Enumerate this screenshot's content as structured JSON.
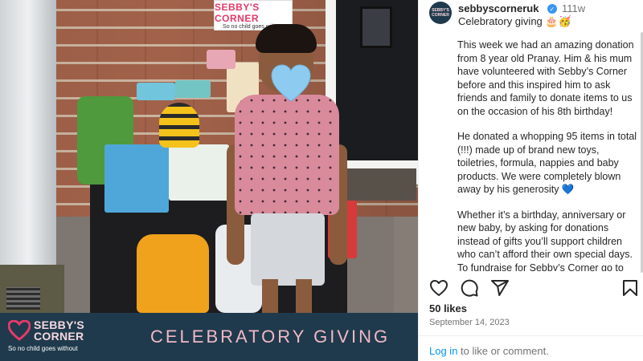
{
  "post": {
    "sign_logo": "SEBBY'S CORNER",
    "sign_tagline": "So no child goes without",
    "banner": {
      "logo_line1": "SEBBY'S",
      "logo_line2": "CORNER",
      "logo_tagline": "So no child goes without",
      "title": "CELEBRATORY GIVING"
    },
    "overlay_emoji": "blue-heart-emoji"
  },
  "header": {
    "avatar_text": "SEBBY'S CORNER",
    "username": "sebbyscorneruk",
    "time_ago": "111w",
    "caption_title": "Celebratory giving 🎂🥳"
  },
  "caption": {
    "p1": "This week we had an amazing donation from 8 year old Pranay. Him & his mum have volunteered with Sebby’s Corner before and this inspired him to ask friends and family to donate items to us on the occasion of his 8th birthday!",
    "p2": "He donated a whopping 95 items in total (!!!) made up of brand new toys, toiletries, formula, nappies and baby products. We were completely blown away by his generosity 💙",
    "p3": "Whether it’s a birthday, anniversary or new baby, by asking for donations instead of gifts you’ll support children who can’t afford their own special days. To fundraise for Sebby’s Corner go to our website."
  },
  "actions": {
    "icons": [
      "heart-icon",
      "comment-icon",
      "share-icon",
      "bookmark-icon"
    ]
  },
  "likes": "50 likes",
  "date": "September 14, 2023",
  "login": {
    "link": "Log in",
    "rest": " to like or comment."
  },
  "colors": {
    "brand_navy": "#1f3a4c",
    "brand_pink": "#e5396a",
    "link_blue": "#0095f6",
    "verified_blue": "#3897f0"
  }
}
